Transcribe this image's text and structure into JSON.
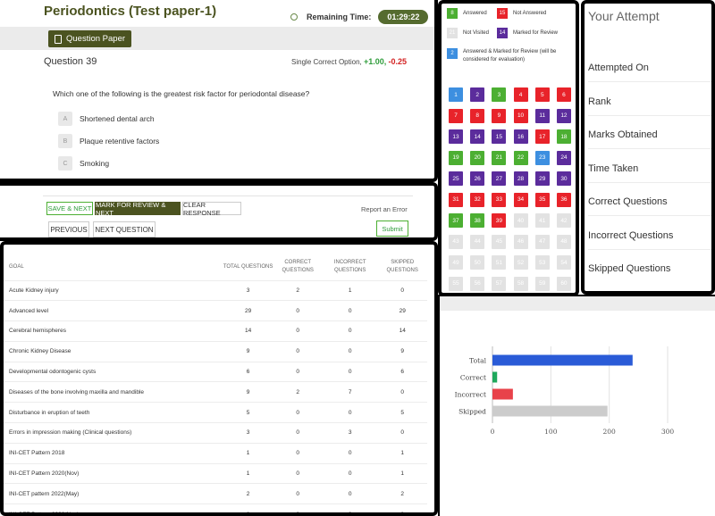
{
  "exam": {
    "title": "Periodontics (Test paper-1)",
    "remaining_label": "Remaining Time:",
    "remaining_time": "01:29:22",
    "question_paper_label": "Question Paper"
  },
  "question": {
    "number_label": "Question 39",
    "type_label": "Single Correct Option,",
    "positive_marks": "+1.00,",
    "negative_marks": "-0.25",
    "text": "Which one of the following is the greatest risk factor for periodontal disease?",
    "options": [
      {
        "key": "A",
        "text": "Shortened dental arch"
      },
      {
        "key": "B",
        "text": "Plaque retentive factors"
      },
      {
        "key": "C",
        "text": "Smoking"
      }
    ]
  },
  "actions": {
    "save_next": "SAVE & NEXT",
    "mark_review_next": "MARK FOR REVIEW & NEXT",
    "clear_response": "CLEAR RESPONSE",
    "report_error": "Report an Error",
    "previous": "PREVIOUS",
    "next_question": "NEXT QUESTION",
    "submit": "Submit"
  },
  "legend": {
    "answered": {
      "count": "8",
      "label": "Answered",
      "color": "#4caf32"
    },
    "not_answered": {
      "count": "15",
      "label": "Not Answered",
      "color": "#e8232a"
    },
    "not_visited": {
      "count": "21",
      "label": "Not Visited",
      "color": "#e2e2e2"
    },
    "marked_review": {
      "count": "14",
      "label": "Marked for Review",
      "color": "#5b2c9c"
    },
    "answered_marked": {
      "count": "2",
      "label": "Answered & Marked for Review (will be considered for evaluation)",
      "color": "#3d8fe0"
    }
  },
  "palette": [
    {
      "n": "1",
      "s": "am"
    },
    {
      "n": "2",
      "s": "m"
    },
    {
      "n": "3",
      "s": "a"
    },
    {
      "n": "4",
      "s": "na"
    },
    {
      "n": "5",
      "s": "na"
    },
    {
      "n": "6",
      "s": "na"
    },
    {
      "n": "7",
      "s": "na"
    },
    {
      "n": "8",
      "s": "na"
    },
    {
      "n": "9",
      "s": "na"
    },
    {
      "n": "10",
      "s": "na"
    },
    {
      "n": "11",
      "s": "m"
    },
    {
      "n": "12",
      "s": "m"
    },
    {
      "n": "13",
      "s": "m"
    },
    {
      "n": "14",
      "s": "m"
    },
    {
      "n": "15",
      "s": "m"
    },
    {
      "n": "16",
      "s": "m"
    },
    {
      "n": "17",
      "s": "na"
    },
    {
      "n": "18",
      "s": "a"
    },
    {
      "n": "19",
      "s": "a"
    },
    {
      "n": "20",
      "s": "a"
    },
    {
      "n": "21",
      "s": "a"
    },
    {
      "n": "22",
      "s": "a"
    },
    {
      "n": "23",
      "s": "am"
    },
    {
      "n": "24",
      "s": "m"
    },
    {
      "n": "25",
      "s": "m"
    },
    {
      "n": "26",
      "s": "m"
    },
    {
      "n": "27",
      "s": "m"
    },
    {
      "n": "28",
      "s": "m"
    },
    {
      "n": "29",
      "s": "m"
    },
    {
      "n": "30",
      "s": "m"
    },
    {
      "n": "31",
      "s": "na"
    },
    {
      "n": "32",
      "s": "na"
    },
    {
      "n": "33",
      "s": "na"
    },
    {
      "n": "34",
      "s": "na"
    },
    {
      "n": "35",
      "s": "na"
    },
    {
      "n": "36",
      "s": "na"
    },
    {
      "n": "37",
      "s": "a"
    },
    {
      "n": "38",
      "s": "a"
    },
    {
      "n": "39",
      "s": "na"
    },
    {
      "n": "40",
      "s": "nv"
    },
    {
      "n": "41",
      "s": "nv"
    },
    {
      "n": "42",
      "s": "nv"
    },
    {
      "n": "43",
      "s": "nv"
    },
    {
      "n": "44",
      "s": "nv"
    },
    {
      "n": "45",
      "s": "nv"
    },
    {
      "n": "46",
      "s": "nv"
    },
    {
      "n": "47",
      "s": "nv"
    },
    {
      "n": "48",
      "s": "nv"
    },
    {
      "n": "49",
      "s": "nv"
    },
    {
      "n": "50",
      "s": "nv"
    },
    {
      "n": "51",
      "s": "nv"
    },
    {
      "n": "52",
      "s": "nv"
    },
    {
      "n": "53",
      "s": "nv"
    },
    {
      "n": "54",
      "s": "nv"
    },
    {
      "n": "55",
      "s": "nv"
    },
    {
      "n": "56",
      "s": "nv"
    },
    {
      "n": "57",
      "s": "nv"
    },
    {
      "n": "58",
      "s": "nv"
    },
    {
      "n": "59",
      "s": "nv"
    },
    {
      "n": "60",
      "s": "nv"
    }
  ],
  "attempt": {
    "title": "Your Attempt",
    "rows": [
      "Attempted On",
      "Rank",
      "Marks Obtained",
      "Time Taken",
      "Correct Questions",
      "Incorrect Questions",
      "Skipped Questions"
    ]
  },
  "goal_table": {
    "headers": [
      "GOAL",
      "TOTAL QUESTIONS",
      "CORRECT QUESTIONS",
      "INCORRECT QUESTIONS",
      "SKIPPED QUESTIONS"
    ],
    "rows": [
      [
        "Acute Kidney injury",
        "3",
        "2",
        "1",
        "0"
      ],
      [
        "Advanced level",
        "29",
        "0",
        "0",
        "29"
      ],
      [
        "Cerebral hemispheres",
        "14",
        "0",
        "0",
        "14"
      ],
      [
        "Chronic Kidney Disease",
        "9",
        "0",
        "0",
        "9"
      ],
      [
        "Developmental odontogenic cysts",
        "6",
        "0",
        "0",
        "6"
      ],
      [
        "Diseases of the bone involving maxilla and mandible",
        "9",
        "2",
        "7",
        "0"
      ],
      [
        "Disturbance in eruption of teeth",
        "5",
        "0",
        "0",
        "5"
      ],
      [
        "Errors in impression making (Clinical questions)",
        "3",
        "0",
        "3",
        "0"
      ],
      [
        "INI-CET Pattern 2018",
        "1",
        "0",
        "0",
        "1"
      ],
      [
        "INI-CET Pattern 2020(Nov)",
        "1",
        "0",
        "0",
        "1"
      ],
      [
        "INI-CET pattern 2022(May)",
        "2",
        "0",
        "0",
        "2"
      ],
      [
        "INI-CET Pattern 2022(Nov)",
        "8",
        "0",
        "0",
        "8"
      ]
    ]
  },
  "chart_data": {
    "type": "bar",
    "orientation": "horizontal",
    "categories": [
      "Total",
      "Correct",
      "Incorrect",
      "Skipped"
    ],
    "values": [
      240,
      8,
      35,
      197
    ],
    "colors": [
      "#2a5bd7",
      "#1fa85c",
      "#e8424a",
      "#cccccc"
    ],
    "xlim": [
      0,
      300
    ],
    "xticks": [
      "0",
      "100",
      "200",
      "300"
    ],
    "grid": true
  },
  "colors": {
    "brand": "#4b5320",
    "answered": "#4caf32",
    "not_answered": "#e8232a",
    "not_visited": "#e2e2e2",
    "marked": "#5b2c9c",
    "answered_marked": "#3d8fe0"
  }
}
